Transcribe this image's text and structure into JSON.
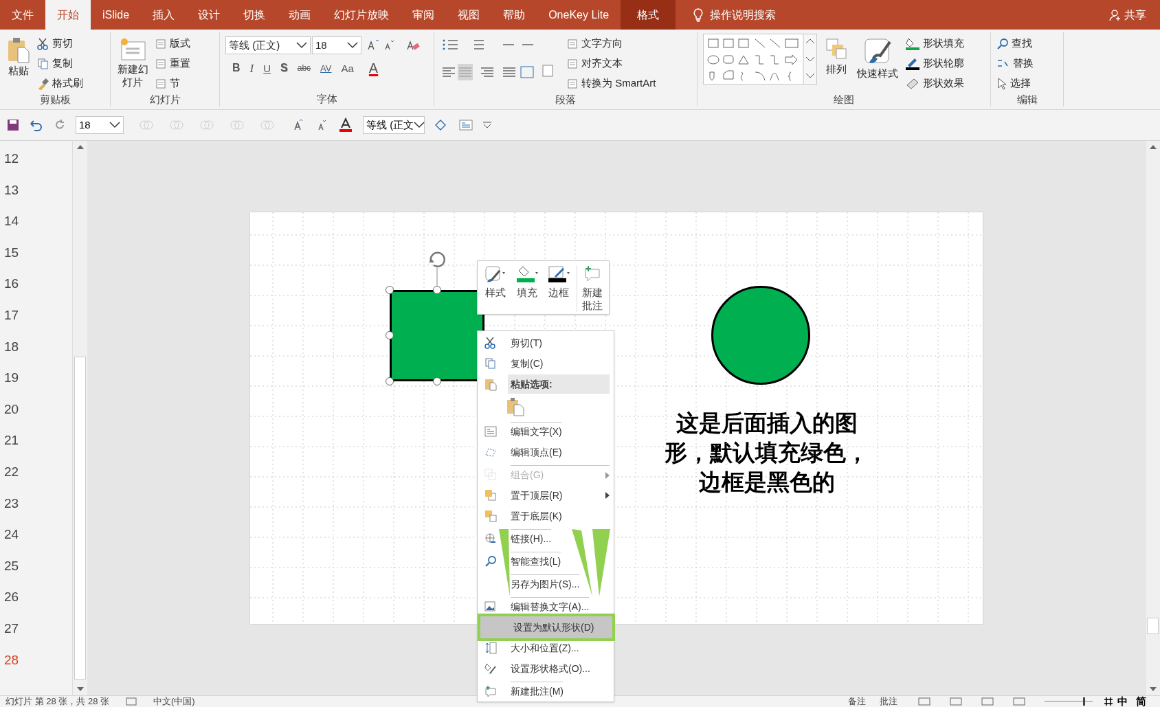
{
  "tabs": [
    {
      "label": "文件",
      "selected": false,
      "kind": "normal"
    },
    {
      "label": "开始",
      "selected": true,
      "kind": "normal"
    },
    {
      "label": "iSlide",
      "selected": false,
      "kind": "normal"
    },
    {
      "label": "插入",
      "selected": false,
      "kind": "normal"
    },
    {
      "label": "设计",
      "selected": false,
      "kind": "normal"
    },
    {
      "label": "切换",
      "selected": false,
      "kind": "normal"
    },
    {
      "label": "动画",
      "selected": false,
      "kind": "normal"
    },
    {
      "label": "幻灯片放映",
      "selected": false,
      "kind": "normal"
    },
    {
      "label": "审阅",
      "selected": false,
      "kind": "normal"
    },
    {
      "label": "视图",
      "selected": false,
      "kind": "normal"
    },
    {
      "label": "帮助",
      "selected": false,
      "kind": "normal"
    },
    {
      "label": "OneKey Lite",
      "selected": false,
      "kind": "normal"
    },
    {
      "label": "格式",
      "selected": false,
      "kind": "contextual"
    }
  ],
  "tell_me": "操作说明搜索",
  "share": "共享",
  "ribbon": [
    {
      "label": "剪贴板",
      "kind": "standard",
      "large": [
        "粘贴"
      ],
      "small": [
        "剪切",
        "复制",
        "格式刷"
      ]
    },
    {
      "label": "幻灯片",
      "kind": "standard",
      "large": [
        "新建幻灯片"
      ],
      "small": [
        "版式",
        "重置",
        "节"
      ]
    },
    {
      "label": "字体",
      "kind": "font",
      "font": "等线 (正文)",
      "size": "18",
      "format_buttons": [
        "B",
        "I",
        "U",
        "S",
        "abc",
        "AV",
        "Aa",
        "A"
      ]
    },
    {
      "label": "段落",
      "kind": "paragraph",
      "small": [
        "文字方向",
        "对齐文本",
        "转换为 SmartArt"
      ]
    },
    {
      "label": "绘图",
      "kind": "drawing",
      "large": [
        "排列",
        "快速样式"
      ],
      "small": [
        "形状填充",
        "形状轮廓",
        "形状效果"
      ]
    },
    {
      "label": "编辑",
      "kind": "standard",
      "small": [
        "查找",
        "替换",
        "选择"
      ]
    }
  ],
  "quick_access": {
    "size": "18",
    "font": "等线 (正文"
  },
  "slide_numbers": [
    {
      "label": "12",
      "selected": false
    },
    {
      "label": "13",
      "selected": false
    },
    {
      "label": "14",
      "selected": false
    },
    {
      "label": "15",
      "selected": false
    },
    {
      "label": "16",
      "selected": false
    },
    {
      "label": "17",
      "selected": false
    },
    {
      "label": "18",
      "selected": false
    },
    {
      "label": "19",
      "selected": false
    },
    {
      "label": "20",
      "selected": false
    },
    {
      "label": "21",
      "selected": false
    },
    {
      "label": "22",
      "selected": false
    },
    {
      "label": "23",
      "selected": false
    },
    {
      "label": "24",
      "selected": false
    },
    {
      "label": "25",
      "selected": false
    },
    {
      "label": "26",
      "selected": false
    },
    {
      "label": "27",
      "selected": false
    },
    {
      "label": "28",
      "selected": true
    }
  ],
  "slide": {
    "note": "这是后面插入的图形，默认填充绿色，边框是黑色的"
  },
  "mini_toolbar": [
    "样式",
    "填充",
    "边框",
    "新建批注"
  ],
  "context_menu": [
    {
      "label": "剪切(T)",
      "kind": "item",
      "disabled": false,
      "submenu": false,
      "separator_before": false,
      "selected": false
    },
    {
      "label": "复制(C)",
      "kind": "item",
      "disabled": false,
      "submenu": false,
      "separator_before": false,
      "selected": false
    },
    {
      "label": "粘贴选项:",
      "kind": "header",
      "disabled": false,
      "submenu": false,
      "separator_before": false,
      "selected": false
    },
    {
      "kind": "paste-icons",
      "disabled": false,
      "selected": false
    },
    {
      "label": "编辑文字(X)",
      "kind": "item",
      "disabled": false,
      "submenu": false,
      "separator_before": true,
      "selected": false
    },
    {
      "label": "编辑顶点(E)",
      "kind": "item",
      "disabled": false,
      "submenu": false,
      "separator_before": false,
      "selected": false
    },
    {
      "label": "组合(G)",
      "kind": "item",
      "disabled": true,
      "submenu": true,
      "separator_before": true,
      "selected": false
    },
    {
      "label": "置于顶层(R)",
      "kind": "item",
      "disabled": false,
      "submenu": true,
      "separator_before": false,
      "selected": false
    },
    {
      "label": "置于底层(K)",
      "kind": "item",
      "disabled": false,
      "submenu": false,
      "separator_before": false,
      "selected": false
    },
    {
      "label": "链接(H)...",
      "kind": "item",
      "disabled": false,
      "submenu": false,
      "separator_before": true,
      "selected": false
    },
    {
      "label": "智能查找(L)",
      "kind": "item",
      "disabled": false,
      "submenu": false,
      "separator_before": true,
      "selected": false
    },
    {
      "label": "另存为图片(S)...",
      "kind": "item",
      "disabled": false,
      "submenu": false,
      "separator_before": true,
      "selected": false
    },
    {
      "label": "编辑替换文字(A)...",
      "kind": "item",
      "disabled": false,
      "submenu": false,
      "separator_before": true,
      "selected": false
    },
    {
      "label": "设置为默认形状(D)",
      "kind": "item",
      "disabled": false,
      "submenu": false,
      "separator_before": false,
      "selected": true
    },
    {
      "label": "大小和位置(Z)...",
      "kind": "item",
      "disabled": false,
      "submenu": false,
      "separator_before": false,
      "selected": false
    },
    {
      "label": "设置形状格式(O)...",
      "kind": "item",
      "disabled": false,
      "submenu": false,
      "separator_before": false,
      "selected": false
    },
    {
      "label": "新建批注(M)",
      "kind": "item",
      "disabled": false,
      "submenu": false,
      "separator_before": true,
      "selected": false
    }
  ],
  "status_bar": {
    "slide_info": "幻灯片 第 28 张，共 28 张",
    "language": "中文(中国)",
    "notes": "备注",
    "comments": "批注",
    "ime": [
      "中",
      "简"
    ],
    "zoom": {
      "level": 0.83
    }
  }
}
